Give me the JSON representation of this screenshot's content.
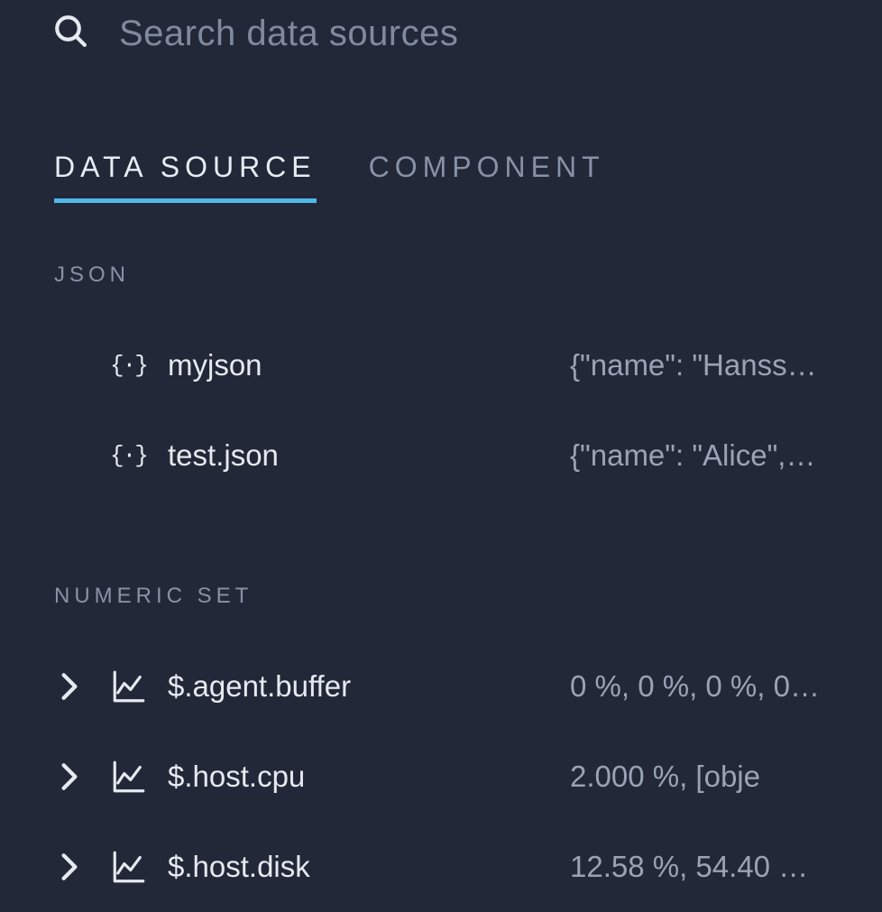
{
  "search": {
    "placeholder": "Search data sources",
    "value": ""
  },
  "tabs": {
    "data_source": "DATA SOURCE",
    "component": "COMPONENT",
    "active": "data_source"
  },
  "sections": {
    "json": {
      "label": "JSON",
      "rows": [
        {
          "name": "myjson",
          "value": "{\"name\": \"Hanss…"
        },
        {
          "name": "test.json",
          "value": "{\"name\": \"Alice\",…"
        }
      ]
    },
    "numeric": {
      "label": "NUMERIC SET",
      "rows": [
        {
          "name": "$.agent.buffer",
          "value": "0 %, 0 %, 0 %, 0…"
        },
        {
          "name": "$.host.cpu",
          "value": "2.000 %, [obje"
        },
        {
          "name": "$.host.disk",
          "value": "12.58 %, 54.40 …"
        }
      ]
    }
  }
}
